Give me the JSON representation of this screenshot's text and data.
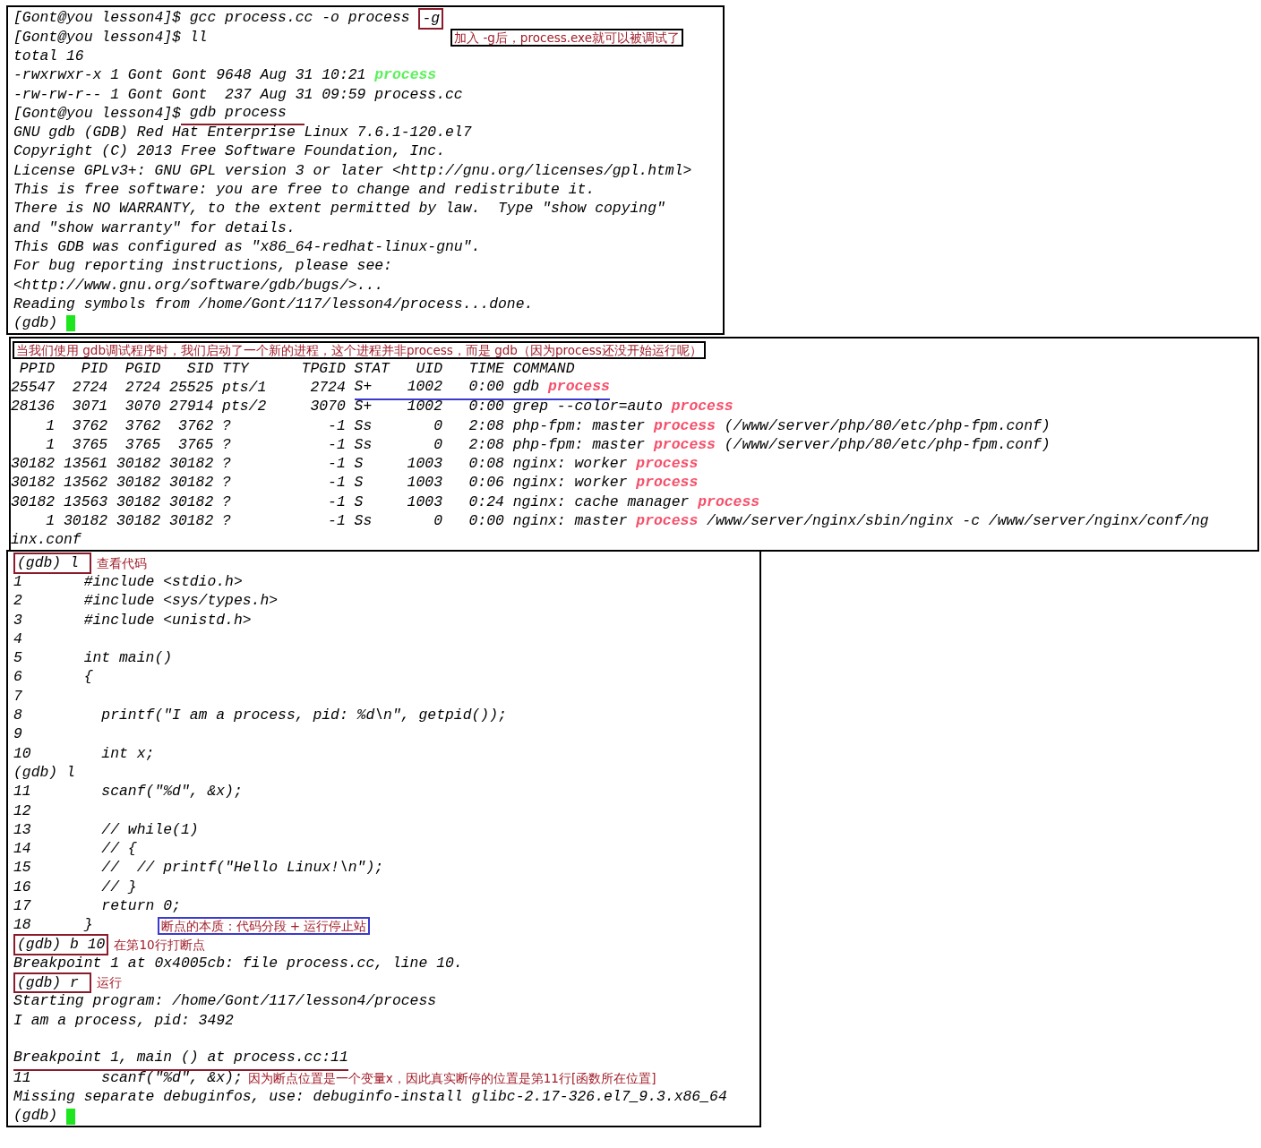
{
  "panels": [
    {
      "lines": [
        {
          "kind": "text",
          "segments": [
            {
              "kind": "text",
              "text": "[Gont@you lesson4]$ gcc process.cc -o process "
            },
            {
              "kind": "text",
              "text": "-g",
              "boxed": true,
              "color": "#8b1a2a"
            }
          ]
        },
        {
          "kind": "text",
          "segments": [
            {
              "kind": "text",
              "text": "[Gont@you lesson4]$ ll"
            },
            {
              "kind": "callout",
              "text": "加入 -g后，process.exe就可以被调试了",
              "boxed": true,
              "color": "#000000"
            }
          ]
        },
        {
          "kind": "text",
          "segments": [
            {
              "kind": "text",
              "text": "total 16"
            }
          ]
        },
        {
          "kind": "text",
          "segments": [
            {
              "kind": "text",
              "text": "-rwxrwxr-x 1 Gont Gont 9648 Aug 31 10:21 "
            },
            {
              "kind": "exe",
              "text": "process"
            }
          ]
        },
        {
          "kind": "text",
          "segments": [
            {
              "kind": "text",
              "text": "-rw-rw-r-- 1 Gont Gont  237 Aug 31 09:59 process.cc"
            }
          ]
        },
        {
          "kind": "text",
          "segments": [
            {
              "kind": "text",
              "text": "[Gont@you lesson4]$"
            },
            {
              "kind": "text",
              "text": " gdb process  ",
              "underlined": true,
              "color": "#8b1a2a"
            }
          ]
        },
        {
          "kind": "text",
          "segments": [
            {
              "kind": "text",
              "text": "GNU gdb (GDB) Red Hat Enterprise Linux 7.6.1-120.el7"
            }
          ]
        },
        {
          "kind": "text",
          "segments": [
            {
              "kind": "text",
              "text": "Copyright (C) 2013 Free Software Foundation, Inc."
            }
          ]
        },
        {
          "kind": "text",
          "segments": [
            {
              "kind": "text",
              "text": "License GPLv3+: GNU GPL version 3 or later <http://gnu.org/licenses/gpl.html>"
            }
          ]
        },
        {
          "kind": "text",
          "segments": [
            {
              "kind": "text",
              "text": "This is free software: you are free to change and redistribute it."
            }
          ]
        },
        {
          "kind": "text",
          "segments": [
            {
              "kind": "text",
              "text": "There is NO WARRANTY, to the extent permitted by law.  Type \"show copying\""
            }
          ]
        },
        {
          "kind": "text",
          "segments": [
            {
              "kind": "text",
              "text": "and \"show warranty\" for details."
            }
          ]
        },
        {
          "kind": "text",
          "segments": [
            {
              "kind": "text",
              "text": "This GDB was configured as \"x86_64-redhat-linux-gnu\"."
            }
          ]
        },
        {
          "kind": "text",
          "segments": [
            {
              "kind": "text",
              "text": "For bug reporting instructions, please see:"
            }
          ]
        },
        {
          "kind": "text",
          "segments": [
            {
              "kind": "text",
              "text": "<http://www.gnu.org/software/gdb/bugs/>..."
            }
          ]
        },
        {
          "kind": "text",
          "segments": [
            {
              "kind": "text",
              "text": "Reading symbols from /home/Gont/117/lesson4/process...done."
            }
          ]
        },
        {
          "kind": "text",
          "segments": [
            {
              "kind": "text",
              "text": "(gdb) "
            },
            {
              "kind": "cursor"
            }
          ]
        }
      ]
    },
    {
      "lines": [
        {
          "kind": "text",
          "segments": [
            {
              "kind": "note",
              "text": "当我们使用 gdb调试程序时，我们启动了一个新的进程，这个进程并非process，而是 gdb（因为process还没开始运行呢）",
              "boxed": true,
              "color": "#000000"
            }
          ]
        },
        {
          "kind": "text",
          "segments": [
            {
              "kind": "text",
              "text": " PPID   PID  PGID   SID TTY      TPGID STAT   UID   TIME COMMAND"
            }
          ]
        },
        {
          "kind": "text",
          "segments": [
            {
              "kind": "text",
              "text": "25547  2724  2724 25525 pts/1     2724 "
            },
            {
              "kind": "text",
              "text": "S+    1002   0:00 gdb ",
              "underlined": true,
              "color": "#3a3ad0"
            },
            {
              "kind": "match",
              "text": "process",
              "underlined": true,
              "color": "#3a3ad0"
            }
          ]
        },
        {
          "kind": "text",
          "segments": [
            {
              "kind": "text",
              "text": "28136  3071  3070 27914 pts/2     3070 S+    1002   0:00 grep --color=auto "
            },
            {
              "kind": "match",
              "text": "process"
            }
          ]
        },
        {
          "kind": "text",
          "segments": [
            {
              "kind": "text",
              "text": "    1  3762  3762  3762 ?           -1 Ss       0   2:08 php-fpm: master "
            },
            {
              "kind": "match",
              "text": "process"
            },
            {
              "kind": "text",
              "text": " (/www/server/php/80/etc/php-fpm.conf)"
            }
          ]
        },
        {
          "kind": "text",
          "segments": [
            {
              "kind": "text",
              "text": "    1  3765  3765  3765 ?           -1 Ss       0   2:08 php-fpm: master "
            },
            {
              "kind": "match",
              "text": "process"
            },
            {
              "kind": "text",
              "text": " (/www/server/php/80/etc/php-fpm.conf)"
            }
          ]
        },
        {
          "kind": "text",
          "segments": [
            {
              "kind": "text",
              "text": "30182 13561 30182 30182 ?           -1 S     1003   0:08 nginx: worker "
            },
            {
              "kind": "match",
              "text": "process"
            }
          ]
        },
        {
          "kind": "text",
          "segments": [
            {
              "kind": "text",
              "text": "30182 13562 30182 30182 ?           -1 S     1003   0:06 nginx: worker "
            },
            {
              "kind": "match",
              "text": "process"
            }
          ]
        },
        {
          "kind": "text",
          "segments": [
            {
              "kind": "text",
              "text": "30182 13563 30182 30182 ?           -1 S     1003   0:24 nginx: cache manager "
            },
            {
              "kind": "match",
              "text": "process"
            }
          ]
        },
        {
          "kind": "text",
          "segments": [
            {
              "kind": "text",
              "text": "    1 30182 30182 30182 ?           -1 Ss       0   0:00 nginx: master "
            },
            {
              "kind": "match",
              "text": "process"
            },
            {
              "kind": "text",
              "text": " /www/server/nginx/sbin/nginx -c /www/server/nginx/conf/ng"
            }
          ]
        },
        {
          "kind": "text",
          "segments": [
            {
              "kind": "text",
              "text": "inx.conf"
            }
          ]
        }
      ]
    },
    {
      "lines": [
        {
          "kind": "text",
          "segments": [
            {
              "kind": "text",
              "text": "(gdb) l ",
              "boxed": true,
              "color": "#8b1a2a"
            },
            {
              "kind": "note",
              "text": "查看代码"
            }
          ]
        },
        {
          "kind": "text",
          "segments": [
            {
              "kind": "text",
              "text": "1       #include <stdio.h>"
            }
          ]
        },
        {
          "kind": "text",
          "segments": [
            {
              "kind": "text",
              "text": "2       #include <sys/types.h>"
            }
          ]
        },
        {
          "kind": "text",
          "segments": [
            {
              "kind": "text",
              "text": "3       #include <unistd.h>"
            }
          ]
        },
        {
          "kind": "text",
          "segments": [
            {
              "kind": "text",
              "text": "4"
            }
          ]
        },
        {
          "kind": "text",
          "segments": [
            {
              "kind": "text",
              "text": "5       int main()"
            }
          ]
        },
        {
          "kind": "text",
          "segments": [
            {
              "kind": "text",
              "text": "6       {"
            }
          ]
        },
        {
          "kind": "text",
          "segments": [
            {
              "kind": "text",
              "text": "7"
            }
          ]
        },
        {
          "kind": "text",
          "segments": [
            {
              "kind": "text",
              "text": "8         printf(\"I am a process, pid: %d\\n\", getpid());"
            }
          ]
        },
        {
          "kind": "text",
          "segments": [
            {
              "kind": "text",
              "text": "9"
            }
          ]
        },
        {
          "kind": "text",
          "segments": [
            {
              "kind": "text",
              "text": "10        int x;"
            }
          ]
        },
        {
          "kind": "text",
          "segments": [
            {
              "kind": "text",
              "text": "(gdb) l"
            }
          ]
        },
        {
          "kind": "text",
          "segments": [
            {
              "kind": "text",
              "text": "11        scanf(\"%d\", &x);"
            }
          ]
        },
        {
          "kind": "text",
          "segments": [
            {
              "kind": "text",
              "text": "12"
            }
          ]
        },
        {
          "kind": "text",
          "segments": [
            {
              "kind": "text",
              "text": "13        // while(1)"
            }
          ]
        },
        {
          "kind": "text",
          "segments": [
            {
              "kind": "text",
              "text": "14        // {"
            }
          ]
        },
        {
          "kind": "text",
          "segments": [
            {
              "kind": "text",
              "text": "15        //  // printf(\"Hello Linux!\\n\");"
            }
          ]
        },
        {
          "kind": "text",
          "segments": [
            {
              "kind": "text",
              "text": "16        // }"
            }
          ]
        },
        {
          "kind": "text",
          "segments": [
            {
              "kind": "text",
              "text": "17        return 0;"
            }
          ]
        },
        {
          "kind": "text",
          "segments": [
            {
              "kind": "text",
              "text": "18      }"
            },
            {
              "kind": "aside",
              "text": "断点的本质：代码分段 + 运行停止站",
              "boxed": true,
              "color": "#3a3ad0"
            }
          ]
        },
        {
          "kind": "text",
          "segments": [
            {
              "kind": "text",
              "text": "(gdb) b 10",
              "boxed": true,
              "color": "#8b1a2a"
            },
            {
              "kind": "note",
              "text": "在第10行打断点"
            }
          ]
        },
        {
          "kind": "text",
          "segments": [
            {
              "kind": "text",
              "text": "Breakpoint 1 at 0x4005cb: file process.cc, line 10."
            }
          ]
        },
        {
          "kind": "text",
          "segments": [
            {
              "kind": "text",
              "text": "(gdb) r ",
              "boxed": true,
              "color": "#8b1a2a"
            },
            {
              "kind": "note",
              "text": "运行"
            }
          ]
        },
        {
          "kind": "text",
          "segments": [
            {
              "kind": "text",
              "text": "Starting program: /home/Gont/117/lesson4/process"
            }
          ]
        },
        {
          "kind": "text",
          "segments": [
            {
              "kind": "text",
              "text": "I am a process, pid: 3492"
            }
          ]
        },
        {
          "kind": "blank"
        },
        {
          "kind": "text",
          "segments": [
            {
              "kind": "text",
              "text": "Breakpoint 1, main () at process.cc:11",
              "underlined": true,
              "color": "#8b1a2a"
            }
          ]
        },
        {
          "kind": "text",
          "segments": [
            {
              "kind": "text",
              "text": "11        scanf(\"%d\", &x);"
            },
            {
              "kind": "note",
              "text": "因为断点位置是一个变量x，因此真实断停的位置是第11行[函数所在位置]"
            }
          ]
        },
        {
          "kind": "text",
          "segments": [
            {
              "kind": "text",
              "text": "Missing separate debuginfos, use: debuginfo-install glibc-2.17-326.el7_9.3.x86_64"
            }
          ]
        },
        {
          "kind": "text",
          "segments": [
            {
              "kind": "text",
              "text": "(gdb) "
            },
            {
              "kind": "cursor"
            }
          ]
        }
      ]
    }
  ]
}
